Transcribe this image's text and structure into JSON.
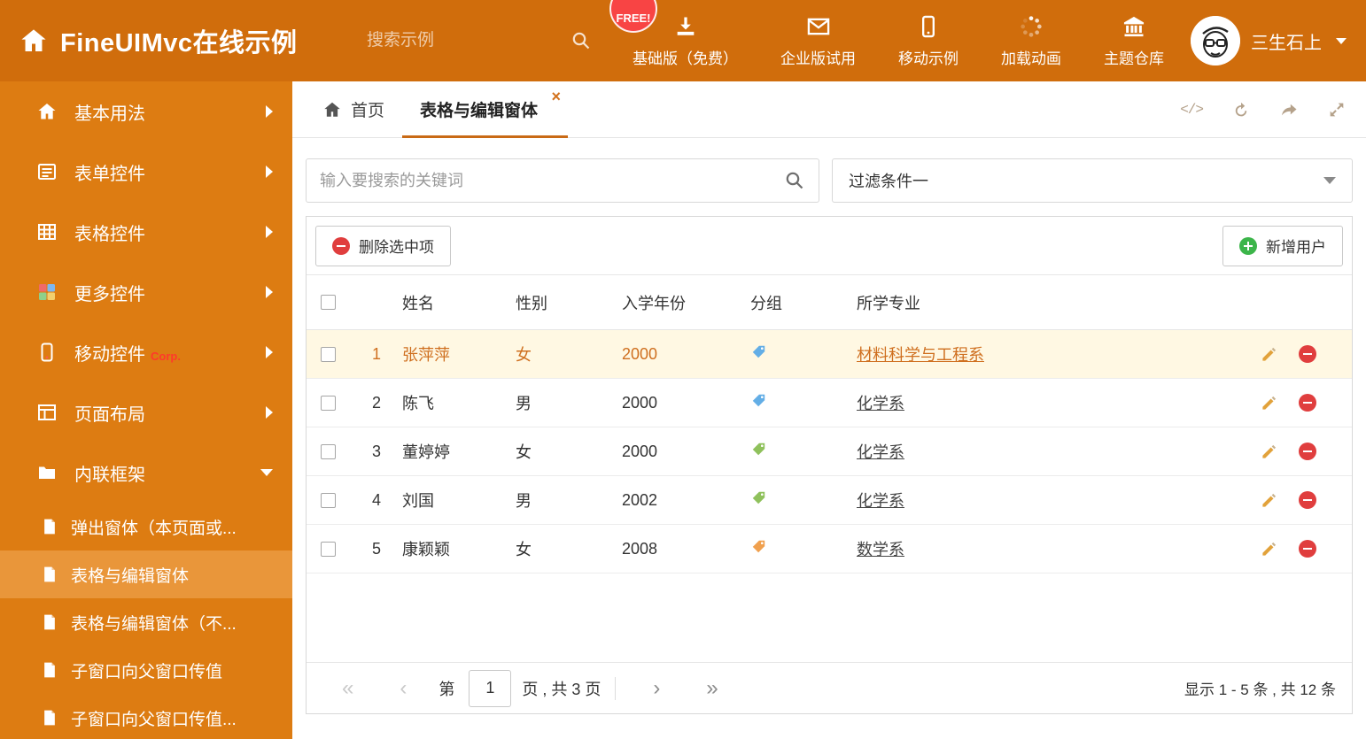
{
  "colors": {
    "topbar": "#d06d0c",
    "sidebar": "#dd7c12",
    "sidebar_selected": "#e9963a",
    "accent_orange": "#c96a15",
    "selected_row_bg": "#fff8e3",
    "selected_row_text": "#cf6f1f",
    "badge_red": "#f84444",
    "delete_red": "#e03e3e",
    "add_green": "#3cb54a",
    "tag_blue": "#63aee6",
    "tag_green": "#8fc15c",
    "tag_orange": "#f0a04e"
  },
  "icons": {
    "brand": "home-icon",
    "top_nav": [
      "download-icon",
      "mail-icon",
      "mobile-icon",
      "spinner-icon",
      "bank-icon"
    ],
    "tab_actions": [
      "code-icon",
      "refresh-icon",
      "share-icon",
      "expand-icon"
    ],
    "code_glyph": "</>"
  },
  "header": {
    "title": "FineUIMvc在线示例",
    "search_placeholder": "搜索示例",
    "free_badge": "FREE!",
    "nav": [
      {
        "label": "基础版（免费）"
      },
      {
        "label": "企业版试用"
      },
      {
        "label": "移动示例"
      },
      {
        "label": "加载动画"
      },
      {
        "label": "主题仓库"
      }
    ],
    "user_name": "三生石上"
  },
  "sidebar": {
    "items": [
      {
        "label": "基本用法"
      },
      {
        "label": "表单控件"
      },
      {
        "label": "表格控件"
      },
      {
        "label": "更多控件"
      },
      {
        "label": "移动控件",
        "badge": "Corp."
      },
      {
        "label": "页面布局"
      },
      {
        "label": "内联框架",
        "expanded": true
      }
    ],
    "subitems": [
      {
        "label": "弹出窗体（本页面或..."
      },
      {
        "label": "表格与编辑窗体",
        "active": true
      },
      {
        "label": "表格与编辑窗体（不..."
      },
      {
        "label": "子窗口向父窗口传值"
      },
      {
        "label": "子窗口向父窗口传值..."
      }
    ]
  },
  "tabs": {
    "home": "首页",
    "active": "表格与编辑窗体",
    "close_glyph": "×"
  },
  "filter": {
    "search_placeholder": "输入要搜索的关键词",
    "selected_filter": "过滤条件一"
  },
  "buttons": {
    "delete": "删除选中项",
    "add": "新增用户"
  },
  "table": {
    "columns": [
      "姓名",
      "性别",
      "入学年份",
      "分组",
      "所学专业"
    ],
    "rows": [
      {
        "num": "1",
        "name": "张萍萍",
        "gender": "女",
        "year": "2000",
        "tag_color": "blue",
        "major": "材料科学与工程系",
        "selected": true
      },
      {
        "num": "2",
        "name": "陈飞",
        "gender": "男",
        "year": "2000",
        "tag_color": "blue",
        "major": "化学系"
      },
      {
        "num": "3",
        "name": "董婷婷",
        "gender": "女",
        "year": "2000",
        "tag_color": "green",
        "major": "化学系"
      },
      {
        "num": "4",
        "name": "刘国",
        "gender": "男",
        "year": "2002",
        "tag_color": "green",
        "major": "化学系"
      },
      {
        "num": "5",
        "name": "康颖颖",
        "gender": "女",
        "year": "2008",
        "tag_color": "orange",
        "major": "数学系"
      }
    ]
  },
  "pagination": {
    "first_glyph": "«",
    "prev_glyph": "‹",
    "label_prefix": "第",
    "current_page": "1",
    "label_suffix": "页 , 共 3 页",
    "next_glyph": "›",
    "last_glyph": "»",
    "summary": "显示 1 - 5 条 , 共 12 条"
  }
}
